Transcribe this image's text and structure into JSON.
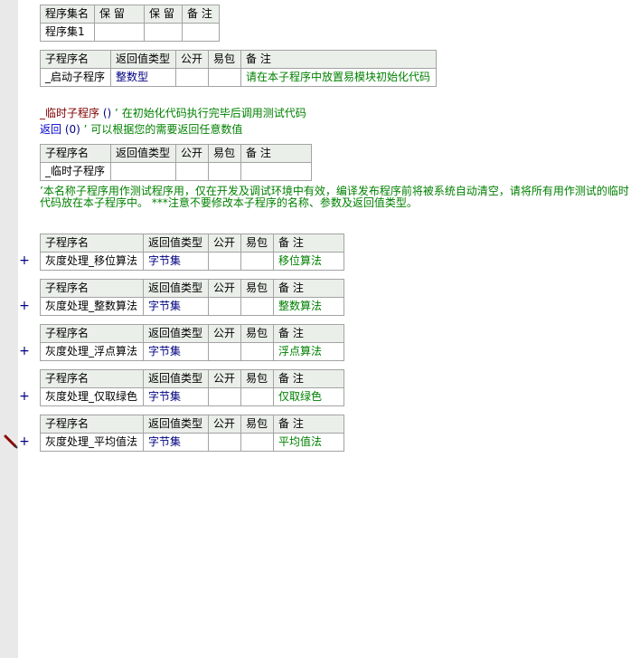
{
  "set_table": {
    "headers": [
      "程序集名",
      "保 留",
      "保 留",
      "备 注"
    ],
    "row": [
      "程序集1",
      "",
      "",
      ""
    ]
  },
  "start_table": {
    "headers": [
      "子程序名",
      "返回值类型",
      "公开",
      "易包",
      "备 注"
    ],
    "row": [
      "_启动子程序",
      "整数型",
      "",
      "",
      "请在本子程序中放置易模块初始化代码"
    ]
  },
  "temp_sub": {
    "name": "_临时子程序",
    "parens": "()",
    "quote": "’",
    "comment": "在初始化代码执行完毕后调用测试代码",
    "return_kw": "返回",
    "return_args": "(0)",
    "return_comment": "可以根据您的需要返回任意数值"
  },
  "temp_table": {
    "headers": [
      "子程序名",
      "返回值类型",
      "公开",
      "易包",
      "备 注"
    ],
    "row": [
      "_临时子程序",
      "",
      "",
      "",
      ""
    ]
  },
  "note": "’本名称子程序用作测试程序用，仅在开发及调试环境中有效，编译发布程序前将被系统自动清空，请将所有用作测试的临时代码放在本子程序中。 ***注意不要修改本子程序的名称、参数及返回值类型。",
  "sub_header": [
    "子程序名",
    "返回值类型",
    "公开",
    "易包",
    "备 注"
  ],
  "expand_symbol": "+",
  "subs": [
    {
      "name": "灰度处理_移位算法",
      "type": "字节集",
      "public": "",
      "pkg": "",
      "remark": "移位算法"
    },
    {
      "name": "灰度处理_整数算法",
      "type": "字节集",
      "public": "",
      "pkg": "",
      "remark": "整数算法"
    },
    {
      "name": "灰度处理_浮点算法",
      "type": "字节集",
      "public": "",
      "pkg": "",
      "remark": "浮点算法"
    },
    {
      "name": "灰度处理_仅取绿色",
      "type": "字节集",
      "public": "",
      "pkg": "",
      "remark": "仅取绿色"
    },
    {
      "name": "灰度处理_平均值法",
      "type": "字节集",
      "public": "",
      "pkg": "",
      "remark": "平均值法"
    }
  ],
  "colors": {
    "header_bg": "#eaf0e9",
    "border": "#a3a3a3",
    "gutter": "#e9e9e9",
    "type_text": "#000080",
    "comment_text": "#008000",
    "sub_name_text": "#800000"
  },
  "icons": {
    "cursor": "pencil-icon"
  }
}
